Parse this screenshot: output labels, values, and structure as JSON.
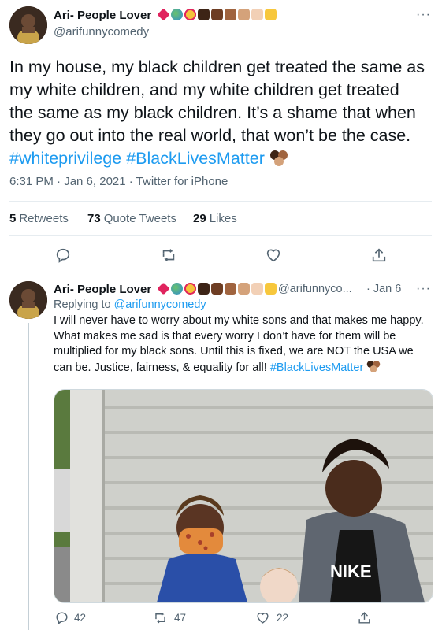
{
  "tweet": {
    "display_name": "Ari- People Lover",
    "handle": "@arifunnycomedy",
    "body": "In my house, my black children get treated the same as my white children, and my white children get treated the same as my black children. It’s a shame that when they go out into the real world, that won’t be the case.",
    "hashtag1": "#whiteprivilege",
    "hashtag2": "#BlackLivesMatter",
    "time": "6:31 PM · Jan 6, 2021 · Twitter for iPhone",
    "retweets_count": "5",
    "retweets_label": "Retweets",
    "quotes_count": "73",
    "quotes_label": "Quote Tweets",
    "likes_count": "29",
    "likes_label": "Likes",
    "more": "···"
  },
  "reply": {
    "display_name": "Ari- People Lover",
    "handle": "@arifunnyco...",
    "date": "· Jan 6",
    "replying_prefix": "Replying to ",
    "replying_handle": "@arifunnycomedy",
    "body": "I will never have to worry about my white sons and that makes me happy. What makes me sad is that every worry I don’t have for them will be multiplied for my black sons. Until this is fixed, we are NOT the USA we can be. Justice, fairness, & equality for all!",
    "hashtag": "#BlackLivesMatter",
    "reply_count": "42",
    "retweet_count": "47",
    "like_count": "22",
    "more": "···",
    "shirt_text": "NIKE"
  },
  "colors": {
    "link": "#1d9bf0",
    "text": "#0f1419",
    "secondary": "#536471",
    "heart": "#e0245e"
  },
  "icons": [
    "reply-icon",
    "retweet-icon",
    "like-icon",
    "share-icon",
    "more-icon",
    "heart-emoji",
    "globe-emoji",
    "hearts-face-emoji",
    "raised-fist-emoji"
  ]
}
